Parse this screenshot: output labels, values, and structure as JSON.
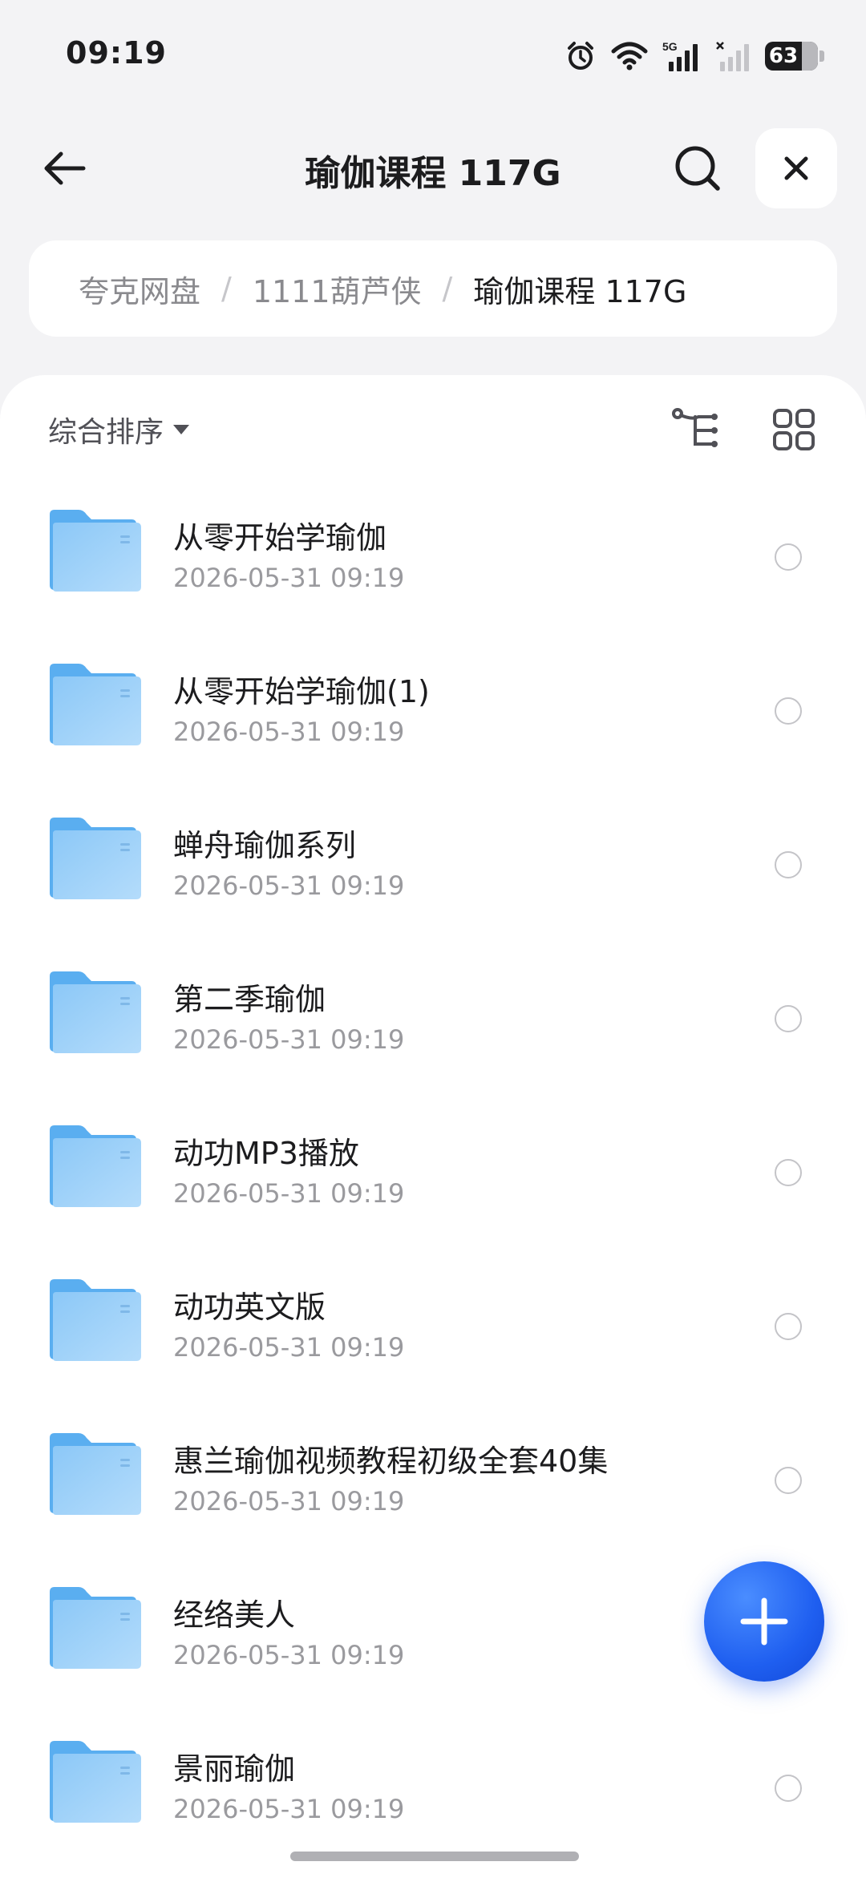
{
  "status_bar": {
    "time": "09:19",
    "network_label": "5G",
    "battery_level": "63",
    "icons": [
      "alarm-icon",
      "wifi-icon",
      "signal-5g-icon",
      "signal-no-service-icon",
      "battery-icon"
    ]
  },
  "header": {
    "title": "瑜伽课程 117G",
    "back_icon": "back-arrow-icon",
    "search_icon": "search-icon",
    "close_icon": "close-icon"
  },
  "breadcrumb": {
    "items": [
      "夸克网盘",
      "1111葫芦侠",
      "瑜伽课程 117G"
    ],
    "separator": "/"
  },
  "toolbar": {
    "sort_label": "综合排序",
    "tree_icon": "folder-tree-icon",
    "grid_icon": "grid-view-icon"
  },
  "files": [
    {
      "name": "从零开始学瑜伽",
      "date": "2026-05-31 09:19"
    },
    {
      "name": "从零开始学瑜伽(1)",
      "date": "2026-05-31 09:19"
    },
    {
      "name": "蝉舟瑜伽系列",
      "date": "2026-05-31 09:19"
    },
    {
      "name": "第二季瑜伽",
      "date": "2026-05-31 09:19"
    },
    {
      "name": "动功MP3播放",
      "date": "2026-05-31 09:19"
    },
    {
      "name": "动功英文版",
      "date": "2026-05-31 09:19"
    },
    {
      "name": "惠兰瑜伽视频教程初级全套40集",
      "date": "2026-05-31 09:19"
    },
    {
      "name": "经络美人",
      "date": "2026-05-31 09:19"
    },
    {
      "name": "景丽瑜伽",
      "date": "2026-05-31 09:19"
    }
  ],
  "fab": {
    "icon": "plus-icon"
  },
  "colors": {
    "background": "#f3f3f5",
    "accent": "#1f5ff0",
    "folder": "#5aaef0"
  }
}
